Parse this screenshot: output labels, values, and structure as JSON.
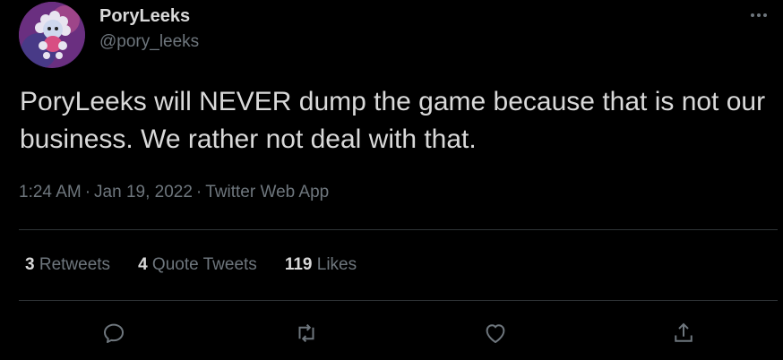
{
  "author": {
    "display_name": "PoryLeeks",
    "handle": "@pory_leeks",
    "avatar_icon": "avatar-image"
  },
  "tweet": {
    "text": "PoryLeeks will NEVER dump the game because that is not our business. We rather not deal with that.",
    "time": "1:24 AM",
    "date": "Jan 19, 2022",
    "source": "Twitter Web App",
    "separator": "·"
  },
  "stats": [
    {
      "count": "3",
      "label": "Retweets"
    },
    {
      "count": "4",
      "label": "Quote Tweets"
    },
    {
      "count": "119",
      "label": "Likes"
    }
  ],
  "actions": [
    {
      "icon": "reply-icon"
    },
    {
      "icon": "retweet-icon"
    },
    {
      "icon": "like-icon"
    },
    {
      "icon": "share-icon"
    }
  ],
  "colors": {
    "background": "#000000",
    "primary_text": "#d9d9d9",
    "secondary_text": "#6e767d",
    "divider": "#2f3336"
  }
}
